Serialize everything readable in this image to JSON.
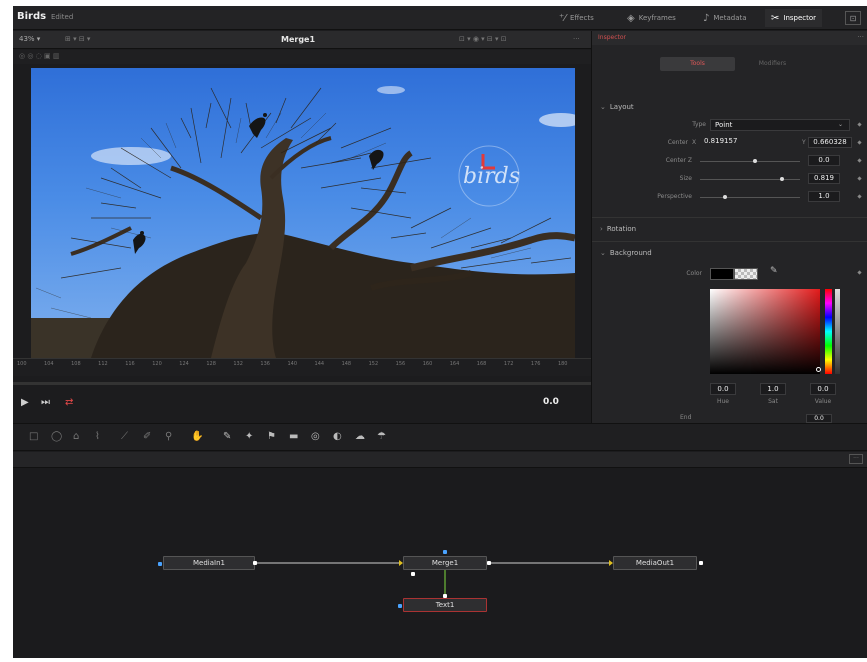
{
  "app": {
    "title": "Birds",
    "status": "Edited"
  },
  "topbar": {
    "effects": {
      "label": "Effects",
      "icon": "effects-icon"
    },
    "keyframes": {
      "label": "Keyframes",
      "icon": "keyframes-icon"
    },
    "metadata": {
      "label": "Metadata",
      "icon": "metadata-icon"
    },
    "inspector": {
      "label": "Inspector",
      "icon": "inspector-icon"
    },
    "corner": "⊡"
  },
  "viewer": {
    "zoom": "43% ▾",
    "title": "Merge1",
    "more": "···",
    "overlay_text": "birds",
    "timecode": "0.0",
    "ruler_ticks": [
      "100",
      "104",
      "108",
      "112",
      "116",
      "120",
      "124",
      "128",
      "132",
      "136",
      "140",
      "144",
      "148",
      "152",
      "156",
      "160",
      "164",
      "168",
      "172",
      "176",
      "180"
    ]
  },
  "inspector": {
    "title": "Inspector",
    "tabs": {
      "tools": "Tools",
      "modifiers": "Modifiers"
    },
    "layout": {
      "header": "Layout",
      "type_label": "Type",
      "type_value": "Point",
      "center_label": "Center",
      "center_x_tag": "X",
      "center_x": "0.819157",
      "center_y_tag": "Y",
      "center_y": "0.660328",
      "center_z_label": "Center Z",
      "center_z": "0.0",
      "center_z_level": 0.55,
      "size_label": "Size",
      "size": "0.819",
      "size_level": 0.82,
      "perspective_label": "Perspective",
      "perspective": "1.0",
      "perspective_level": 0.25
    },
    "rotation": {
      "header": "Rotation"
    },
    "background": {
      "header": "Background",
      "color_label": "Color",
      "hue": "0.0",
      "hue_label": "Hue",
      "sat": "1.0",
      "sat_label": "Sat",
      "value": "0.0",
      "value_label": "Value",
      "end_label": "End",
      "end_value": "0.0"
    }
  },
  "nodes": {
    "media_in": "MediaIn1",
    "merge": "Merge1",
    "media_out": "MediaOut1",
    "text": "Text1",
    "more": "···"
  }
}
